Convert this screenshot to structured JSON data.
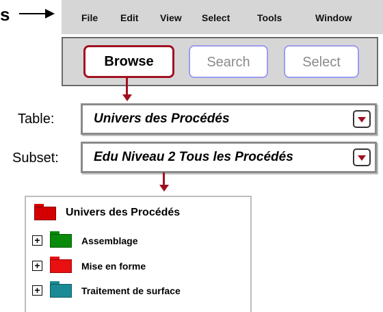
{
  "step_letter": "s",
  "menu": [
    "File",
    "Edit",
    "View",
    "Select",
    "Tools",
    "Window"
  ],
  "toolbar": {
    "browse_label": "Browse",
    "search_label": "Search",
    "select_label": "Select"
  },
  "table": {
    "label": "Table:",
    "value": "Univers des Procédés"
  },
  "subset": {
    "label": "Subset:",
    "value": "Edu Niveau 2 Tous les Procédés"
  },
  "tree": {
    "root": {
      "label": "Univers des Procédés",
      "color": "#d40000"
    },
    "children": [
      {
        "label": "Assemblage",
        "color": "#0a8a0a"
      },
      {
        "label": "Mise en forme",
        "color": "#e81010"
      },
      {
        "label": "Traitement de surface",
        "color": "#1a8a94"
      }
    ]
  },
  "colors": {
    "accent": "#a01020",
    "menubar": "#d6d6d6",
    "inactive_button_border": "#9c9cf0"
  },
  "icons": {
    "expand": "plus-box-icon",
    "dropdown": "triangle-down-icon",
    "folder": "folder-icon"
  }
}
